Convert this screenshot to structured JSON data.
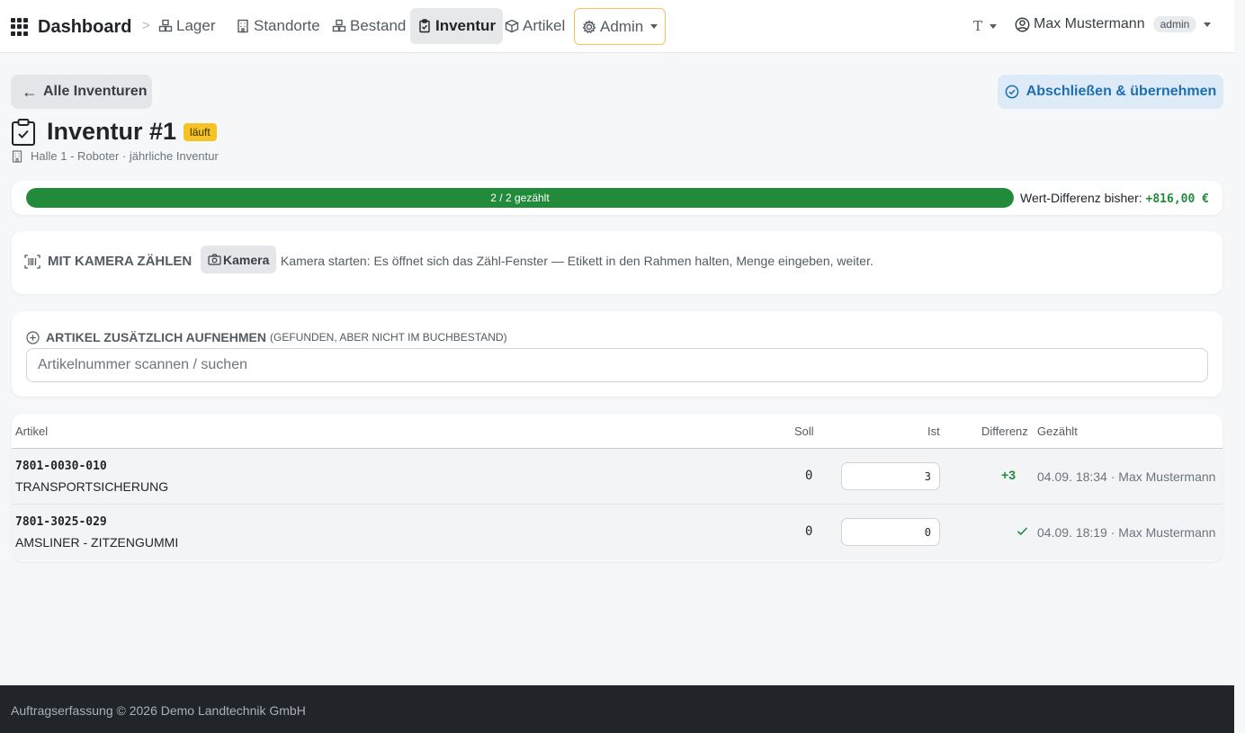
{
  "navbar": {
    "brand": "Dashboard",
    "items": [
      {
        "label": "Lager"
      },
      {
        "label": "Standorte"
      },
      {
        "label": "Bestand"
      },
      {
        "label": "Inventur"
      },
      {
        "label": "Artikel"
      },
      {
        "label": "Admin"
      }
    ],
    "theme_label": "T",
    "user_name": "Max Mustermann",
    "user_role": "admin"
  },
  "header": {
    "back_label": "Alle Inventuren",
    "finish_label": "Abschließen & übernehmen",
    "title": "Inventur #1",
    "status": "läuft",
    "subtitle": "Halle 1 - Roboter · jährliche Inventur"
  },
  "progress": {
    "counted_fraction": 1.0,
    "label": "2 / 2 gezählt",
    "value_diff_label": "Wert-Differenz bisher:",
    "value_diff_amount": "+816,00 €"
  },
  "camera": {
    "title": "MIT KAMERA ZÄHLEN",
    "button_label": "Kamera",
    "hint": "Kamera starten: Es öffnet sich das Zähl-Fenster — Etikett in den Rahmen halten, Menge eingeben, weiter."
  },
  "add_article": {
    "title": "ARTIKEL ZUSÄTZLICH AUFNEHMEN",
    "subtitle": "(GEFUNDEN, ABER NICHT IM BUCHBESTAND)",
    "placeholder": "Artikelnummer scannen / suchen"
  },
  "table": {
    "headers": {
      "artikel": "Artikel",
      "soll": "Soll",
      "ist": "Ist",
      "differenz": "Differenz",
      "gezaehlt": "Gezählt"
    },
    "rows": [
      {
        "sku": "7801-0030-010",
        "name": "TRANSPORTSICHERUNG",
        "soll": "0",
        "ist": "3",
        "diff": "+3",
        "counted": "04.09. 18:34 · Max Mustermann"
      },
      {
        "sku": "7801-3025-029",
        "name": "AMSLINER - ZITZENGUMMI",
        "soll": "0",
        "ist": "0",
        "diff": "",
        "counted": "04.09. 18:19 · Max Mustermann"
      }
    ]
  },
  "footer": {
    "text": "Auftragserfassung © 2026 Demo Landtechnik GmbH"
  },
  "colors": {
    "accent_green": "#228b3b",
    "status_yellow": "#f7c324",
    "primary_blue": "#1f6fae",
    "admin_border": "#f4c35a"
  }
}
